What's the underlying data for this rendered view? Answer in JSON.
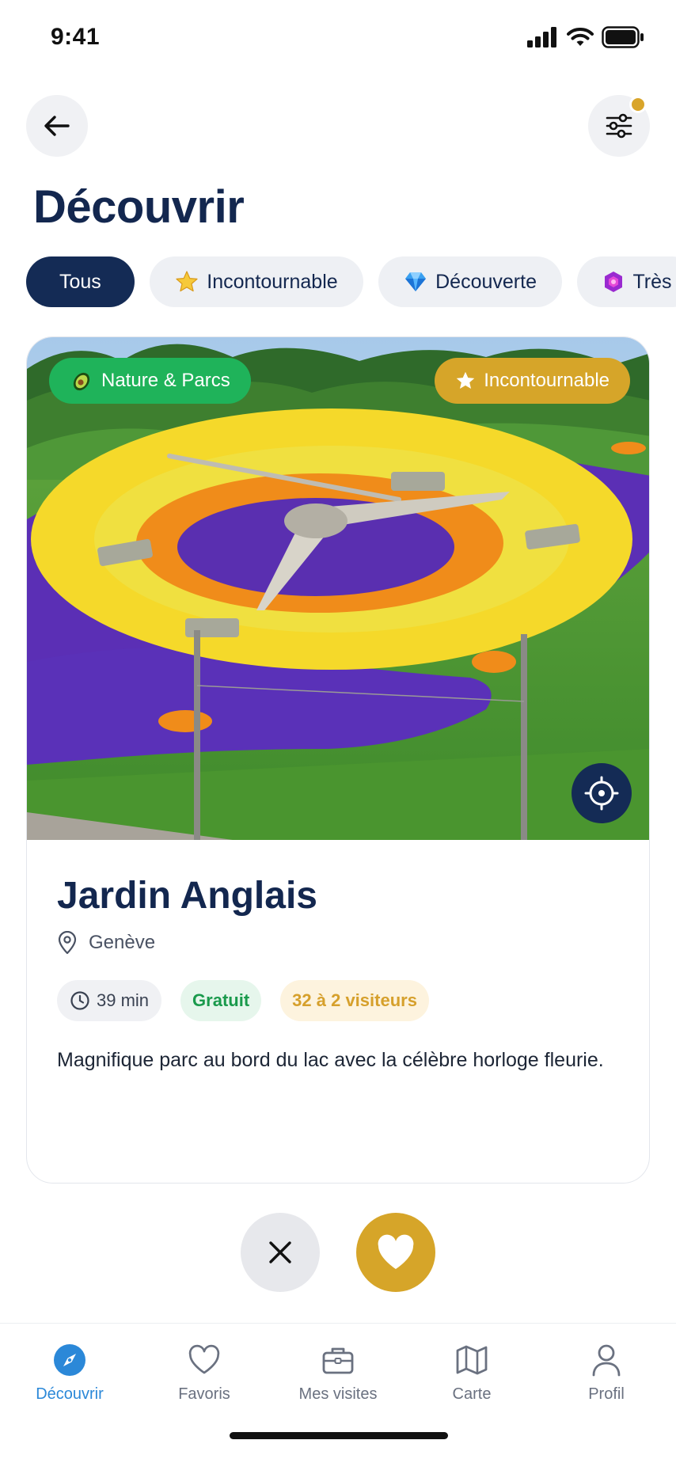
{
  "status": {
    "time": "9:41"
  },
  "header": {
    "title": "Découvrir"
  },
  "filters": [
    {
      "label": "Tous",
      "icon": "",
      "active": true
    },
    {
      "label": "Incontournable",
      "icon": "star-icon",
      "active": false
    },
    {
      "label": "Découverte",
      "icon": "gem-icon",
      "active": false
    },
    {
      "label": "Très",
      "icon": "purple-gem-icon",
      "active": false
    }
  ],
  "card": {
    "category_badge": "Nature & Parcs",
    "tier_badge": "Incontournable",
    "name": "Jardin Anglais",
    "city": "Genève",
    "duration": "39 min",
    "price": "Gratuit",
    "visitors": "32 à 2 visiteurs",
    "description": "Magnifique parc au bord du lac avec la célèbre horloge fleurie."
  },
  "tabbar": {
    "items": [
      {
        "label": "Découvrir",
        "icon": "compass-icon",
        "active": true
      },
      {
        "label": "Favoris",
        "icon": "heart-icon",
        "active": false
      },
      {
        "label": "Mes visites",
        "icon": "briefcase-icon",
        "active": false
      },
      {
        "label": "Carte",
        "icon": "map-icon",
        "active": false
      },
      {
        "label": "Profil",
        "icon": "user-icon",
        "active": false
      }
    ]
  },
  "colors": {
    "primary": "#142b55",
    "accent_gold": "#d6a529",
    "category_green": "#1fb35a",
    "active_tab": "#2b88d8"
  }
}
